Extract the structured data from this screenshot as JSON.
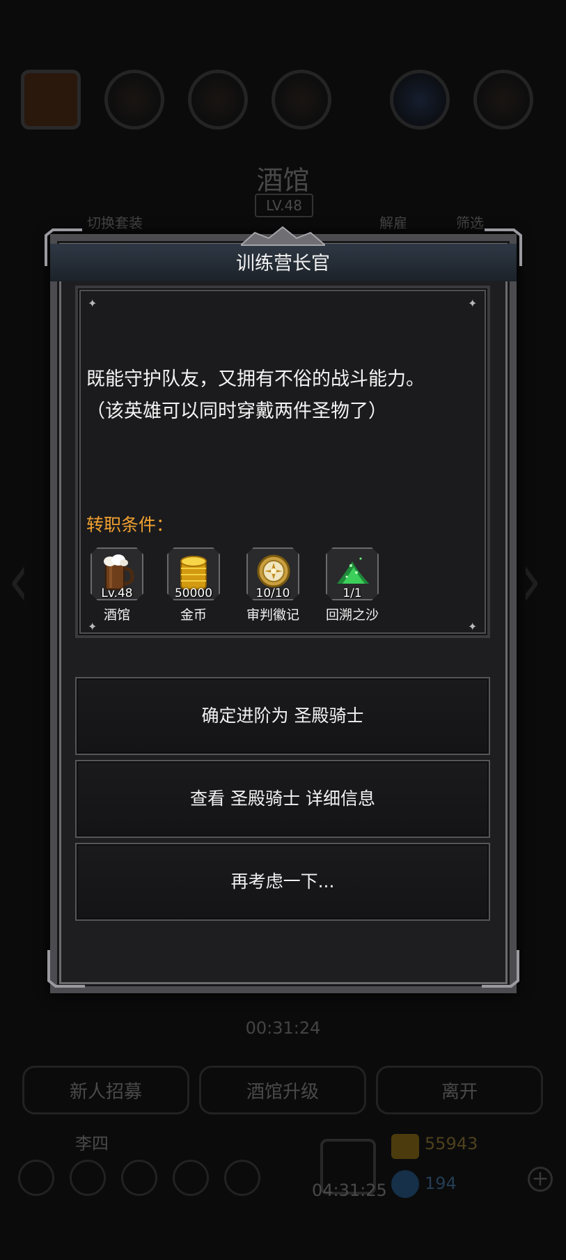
{
  "background": {
    "title": "酒馆",
    "level": "LV.48",
    "tabs": [
      "切换套装",
      "解雇",
      "筛选"
    ],
    "timer_top": "00:31:24",
    "buttons": [
      "新人招募",
      "酒馆升级",
      "离开"
    ],
    "player_name": "李四",
    "gift_timer": "04:31:25",
    "gold": "55943",
    "gems": "194"
  },
  "dialog": {
    "title": "训练营长官",
    "description_line1": "既能守护队友，又拥有不俗的战斗能力。",
    "description_line2": "（该英雄可以同时穿戴两件圣物了）",
    "requirements_title": "转职条件：",
    "requirements": [
      {
        "count": "Lv.48",
        "name": "酒馆",
        "icon": "beer-mug-icon"
      },
      {
        "count": "50000",
        "name": "金币",
        "icon": "gold-coins-icon"
      },
      {
        "count": "10/10",
        "name": "审判徽记",
        "icon": "judgment-emblem-icon"
      },
      {
        "count": "1/1",
        "name": "回溯之沙",
        "icon": "green-sand-icon"
      }
    ],
    "options": [
      "确定进阶为 圣殿骑士",
      "查看 圣殿骑士 详细信息",
      "再考虑一下..."
    ]
  },
  "colors": {
    "requirement_title": "#f0a030",
    "panel": "#1e1e20",
    "gold_text": "#d8b040",
    "gem_text": "#5aa6e8"
  }
}
